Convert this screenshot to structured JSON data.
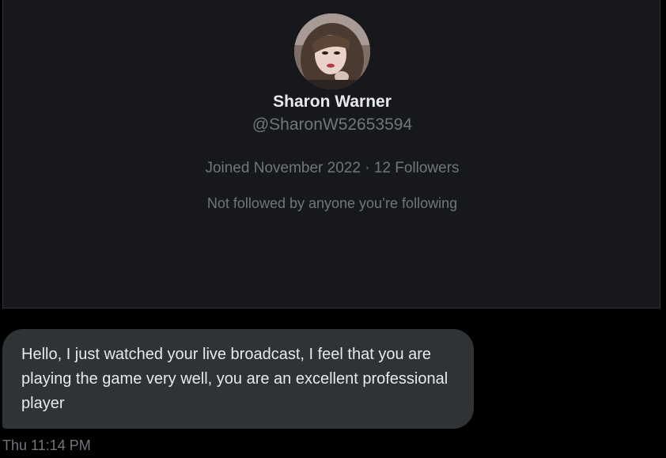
{
  "profile": {
    "display_name": "Sharon Warner",
    "handle": "@SharonW52653594",
    "joined": "Joined November 2022",
    "separator": " · ",
    "followers": "12 Followers",
    "follow_context": "Not followed by anyone you’re following"
  },
  "message": {
    "text": "Hello, I just watched your live broadcast, I feel that you are playing the game very well, you are an excellent professional player",
    "timestamp": "Thu 11:14 PM"
  },
  "colors": {
    "background": "#000000",
    "card": "#16181c",
    "bubble": "#2f3336",
    "primary_text": "#e7e9ea",
    "secondary_text": "#71767b"
  },
  "icons": {
    "avatar": "user-avatar-photo"
  }
}
